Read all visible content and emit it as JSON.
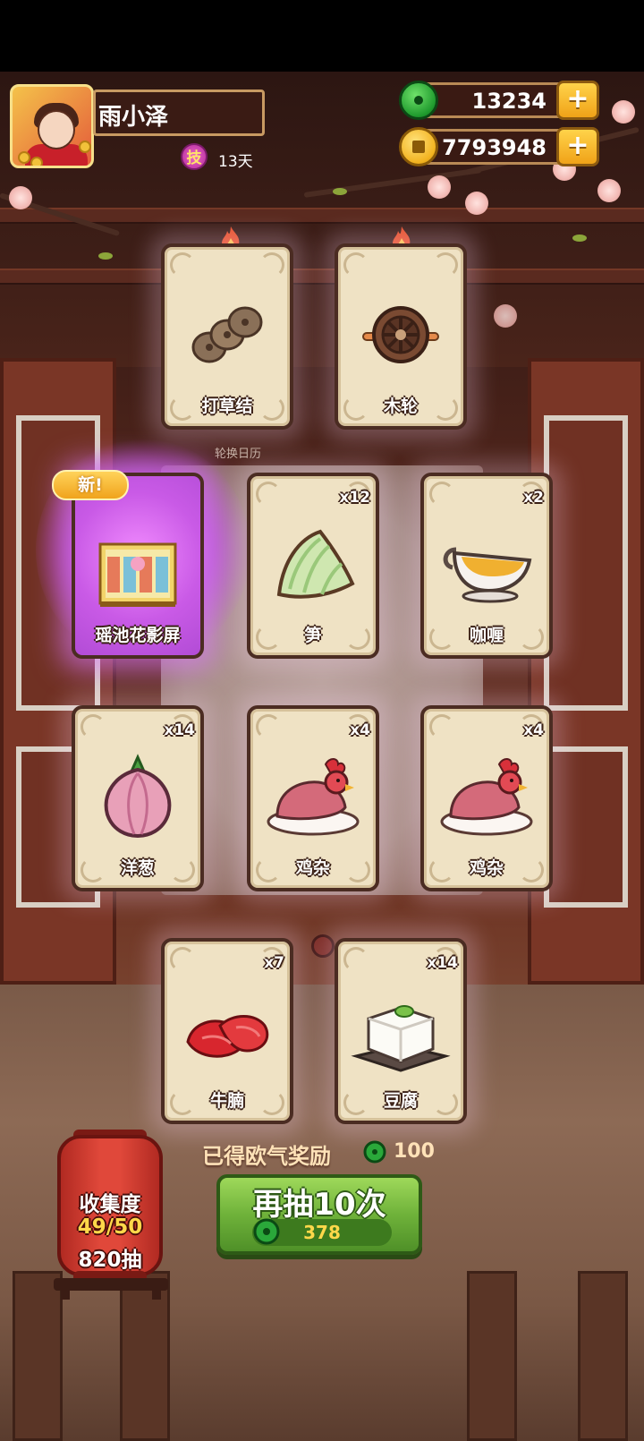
{
  "player": {
    "name": "雨小泽",
    "skill_badge": "技",
    "days": "13天"
  },
  "currencies": [
    {
      "icon": "jade-icon",
      "value": "13234"
    },
    {
      "icon": "coin-icon",
      "value": "7793948"
    }
  ],
  "hint_text": "轮换日历",
  "new_badge": "新!",
  "cards": [
    {
      "name": "打草结",
      "qty": "",
      "icon": "grass-knot-icon",
      "hot": true
    },
    {
      "name": "木轮",
      "qty": "",
      "icon": "wooden-wheel-icon",
      "hot": true
    },
    {
      "name": "瑶池花影屏",
      "qty": "",
      "icon": "flower-screen-icon",
      "new": true
    },
    {
      "name": "笋",
      "qty": "x12",
      "icon": "bamboo-shoot-icon"
    },
    {
      "name": "咖喱",
      "qty": "x2",
      "icon": "curry-gravy-boat-icon"
    },
    {
      "name": "洋葱",
      "qty": "x14",
      "icon": "onion-icon"
    },
    {
      "name": "鸡杂",
      "qty": "x4",
      "icon": "chicken-giblets-icon"
    },
    {
      "name": "鸡杂",
      "qty": "x4",
      "icon": "chicken-giblets-icon"
    },
    {
      "name": "牛腩",
      "qty": "x7",
      "icon": "beef-brisket-icon"
    },
    {
      "name": "豆腐",
      "qty": "x14",
      "icon": "tofu-icon"
    }
  ],
  "collection": {
    "title": "收集度",
    "progress": "49/50",
    "draws": "820抽"
  },
  "reward": {
    "label": "已得欧气奖励",
    "amount": "100"
  },
  "draw_button": {
    "label": "再抽10次",
    "cost": "378"
  },
  "colors": {
    "jade": "#1f9a2d",
    "gold": "#f2b21f",
    "draw_button": "#6fb23a",
    "new_glow": "#c95ae6"
  }
}
